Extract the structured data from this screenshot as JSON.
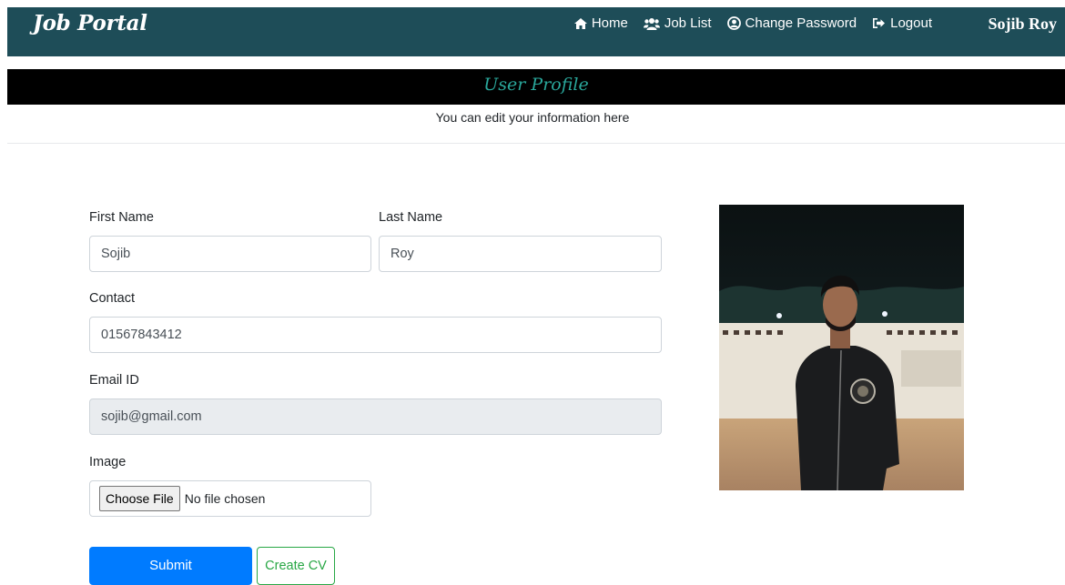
{
  "navbar": {
    "brand": "Job Portal",
    "links": [
      {
        "icon": "home-icon",
        "label": "Home"
      },
      {
        "icon": "users-icon",
        "label": "Job List"
      },
      {
        "icon": "user-circle-icon",
        "label": "Change Password"
      },
      {
        "icon": "logout-icon",
        "label": "Logout"
      }
    ],
    "user_name": "Sojib Roy"
  },
  "banner": {
    "title": "User Profile",
    "subtitle": "You can edit your information here"
  },
  "form": {
    "first_name": {
      "label": "First Name",
      "value": "Sojib"
    },
    "last_name": {
      "label": "Last Name",
      "value": "Roy"
    },
    "contact": {
      "label": "Contact",
      "value": "01567843412"
    },
    "email": {
      "label": "Email ID",
      "value": "sojib@gmail.com"
    },
    "image": {
      "label": "Image",
      "button": "Choose File",
      "status": "No file chosen"
    },
    "submit_label": "Submit",
    "create_cv_label": "Create CV"
  },
  "colors": {
    "navbar": "#1e4d58",
    "banner": "#000000",
    "banner_title": "#2aa79b",
    "primary": "#007bff",
    "success": "#28a745"
  }
}
